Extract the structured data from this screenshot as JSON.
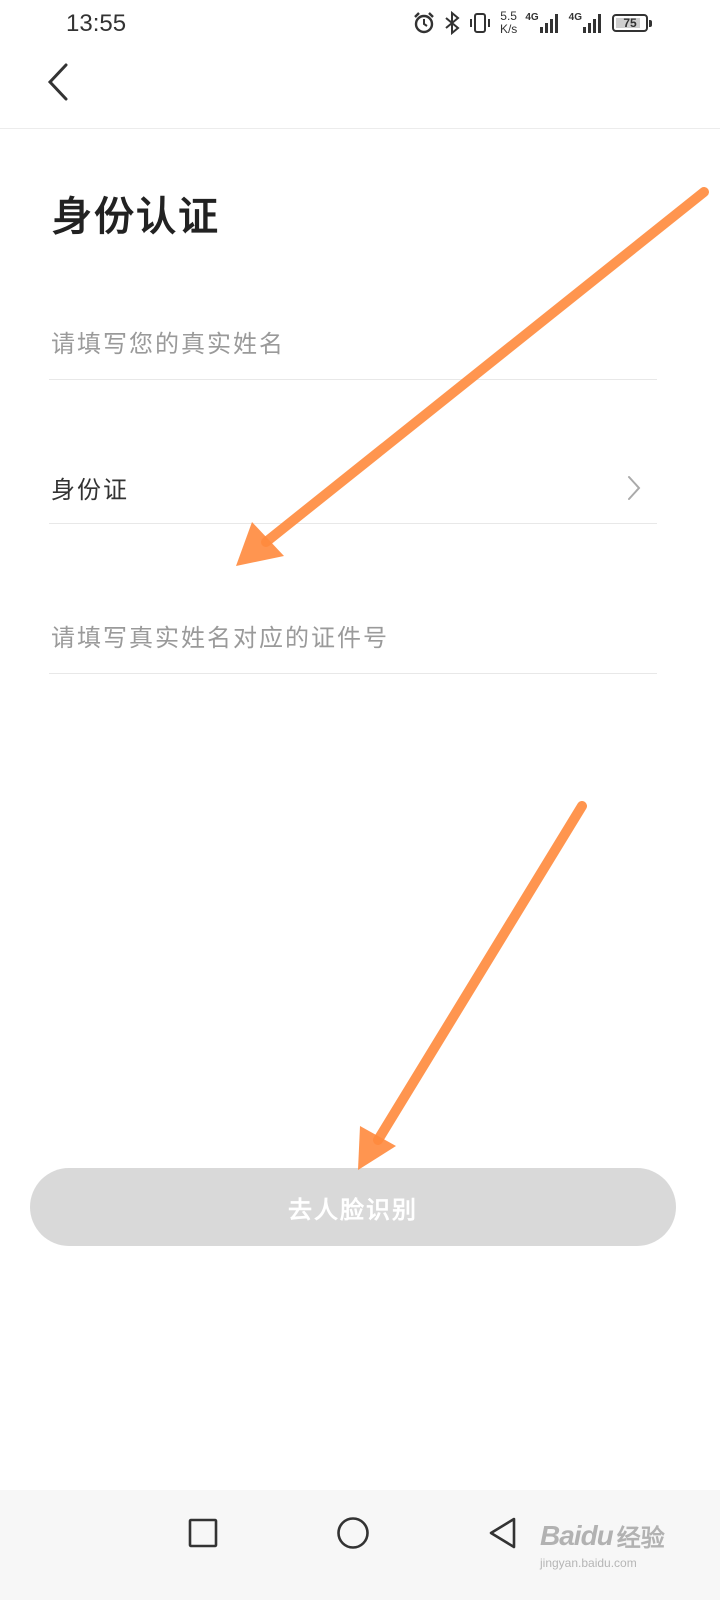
{
  "status_bar": {
    "time": "13:55",
    "net_speed_value": "5.5",
    "net_speed_unit": "K/s",
    "sim1_label": "4G",
    "sim2_label": "4G",
    "battery_level": "75",
    "icons": [
      "alarm-icon",
      "bluetooth-icon",
      "vibrate-icon",
      "signal-icon",
      "signal-icon",
      "battery-icon"
    ]
  },
  "nav": {
    "back_icon": "chevron-left-icon"
  },
  "page": {
    "title": "身份认证"
  },
  "form": {
    "name_placeholder": "请填写您的真实姓名",
    "name_value": "",
    "id_type_label": "身份证",
    "id_type_icon": "chevron-right-icon",
    "id_number_placeholder": "请填写真实姓名对应的证件号",
    "id_number_value": ""
  },
  "actions": {
    "face_recognition_label": "去人脸识别"
  },
  "annotation": {
    "arrow_color": "#ff8a3d"
  },
  "system_nav": {
    "icons": [
      "recent-apps-icon",
      "home-icon",
      "back-icon"
    ]
  },
  "watermark": {
    "brand": "Baidu",
    "sub": "经验",
    "url": "jingyan.baidu.com"
  },
  "colors": {
    "button_disabled_bg": "#d9d9d9",
    "placeholder": "#9a9a9a",
    "divider": "#e8e8e8"
  }
}
